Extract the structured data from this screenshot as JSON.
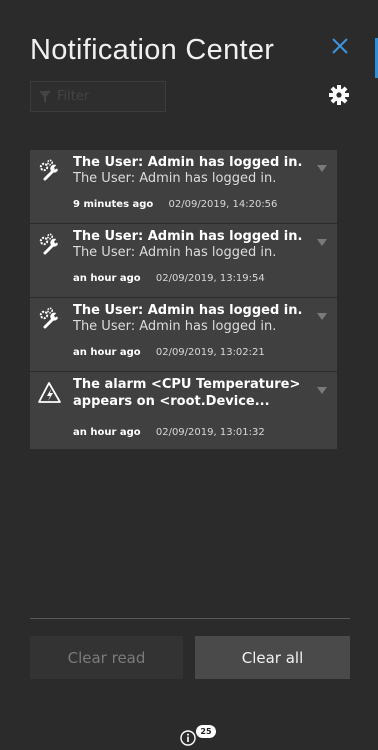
{
  "header": {
    "title": "Notification Center"
  },
  "filter": {
    "placeholder": "Filter",
    "value": ""
  },
  "notifications": [
    {
      "icon": "wrench-gears-icon",
      "title": "The User: Admin has logged in.",
      "subtitle": "The User: Admin has logged in.",
      "ago": "9 minutes ago",
      "timestamp": "02/09/2019, 14:20:56"
    },
    {
      "icon": "wrench-gears-icon",
      "title": "The User: Admin has logged in.",
      "subtitle": "The User: Admin has logged in.",
      "ago": "an hour ago",
      "timestamp": "02/09/2019, 13:19:54"
    },
    {
      "icon": "wrench-gears-icon",
      "title": "The User: Admin has logged in.",
      "subtitle": "The User: Admin has logged in.",
      "ago": "an hour ago",
      "timestamp": "02/09/2019, 13:02:21"
    },
    {
      "icon": "alarm-warning-icon",
      "title": "The alarm <CPU Temperature> appears on <root.Device...",
      "ago": "an hour ago",
      "timestamp": "02/09/2019, 13:01:32"
    }
  ],
  "actions": {
    "clear_read": "Clear read",
    "clear_all": "Clear all"
  },
  "footer": {
    "badge_count": "25"
  },
  "colors": {
    "accent": "#2f8fd8",
    "background": "#2b2b2b",
    "card": "#404040"
  }
}
